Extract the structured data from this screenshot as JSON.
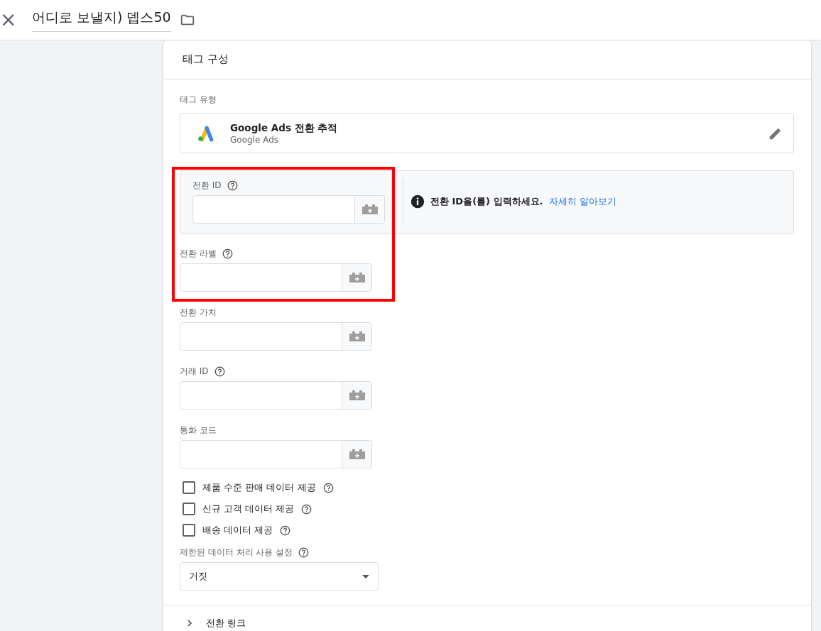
{
  "header": {
    "close": "×",
    "title": "어디로 보낼지) 뎁스50"
  },
  "card": {
    "title": "태그 구성"
  },
  "tag_type": {
    "label": "태그 유형",
    "name": "Google Ads 전환 추적",
    "vendor": "Google Ads"
  },
  "conversion_id": {
    "label": "전환 ID",
    "help": true,
    "info": {
      "text": "전환 ID을(를) 입력하세요.",
      "link": "자세히 알아보기"
    }
  },
  "fields": [
    {
      "label": "전환 라벨",
      "help": true
    },
    {
      "label": "전환 가치",
      "help": false
    },
    {
      "label": "거래 ID",
      "help": true
    },
    {
      "label": "통화 코드",
      "help": false
    }
  ],
  "checkboxes": [
    {
      "label": "제품 수준 판매 데이터 제공",
      "checked": false,
      "help": true
    },
    {
      "label": "신규 고객 데이터 제공",
      "checked": false,
      "help": true
    },
    {
      "label": "배송 데이터 제공",
      "checked": false,
      "help": true
    }
  ],
  "select": {
    "label": "제한된 데이터 처리 사용 설정",
    "help": true,
    "value": "거짓"
  },
  "section": {
    "label": "전환 링크",
    "expanded": false
  }
}
